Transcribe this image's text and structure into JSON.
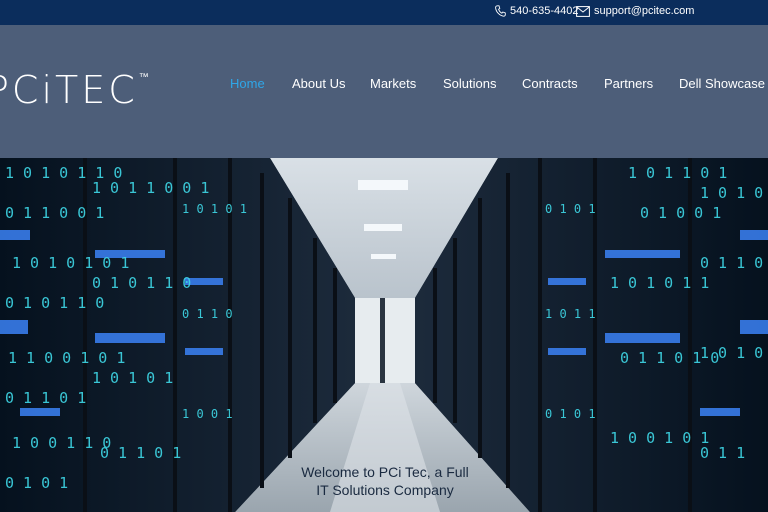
{
  "topbar": {
    "phone": "540-635-4402",
    "email": "support@pcitec.com",
    "phone_icon": "phone-icon",
    "email_icon": "envelope-icon"
  },
  "brand": {
    "logo_text": "PCiTEC",
    "trademark": "™"
  },
  "nav": {
    "items": [
      {
        "label": "Home",
        "active": true
      },
      {
        "label": "About Us"
      },
      {
        "label": "Markets"
      },
      {
        "label": "Solutions"
      },
      {
        "label": "Contracts"
      },
      {
        "label": "Partners"
      },
      {
        "label": "Dell Showcase"
      }
    ]
  },
  "hero": {
    "line1": "Welcome to PCi Tec, a Full",
    "line2": "IT Solutions Company",
    "image": "data-center-server-corridor"
  },
  "colors": {
    "topbar_bg": "#0b2d5c",
    "header_bg": "#4d5e79",
    "nav_active": "#2fa6e8",
    "nav_text": "#ffffff",
    "binary_glow": "#3fd9e8"
  }
}
